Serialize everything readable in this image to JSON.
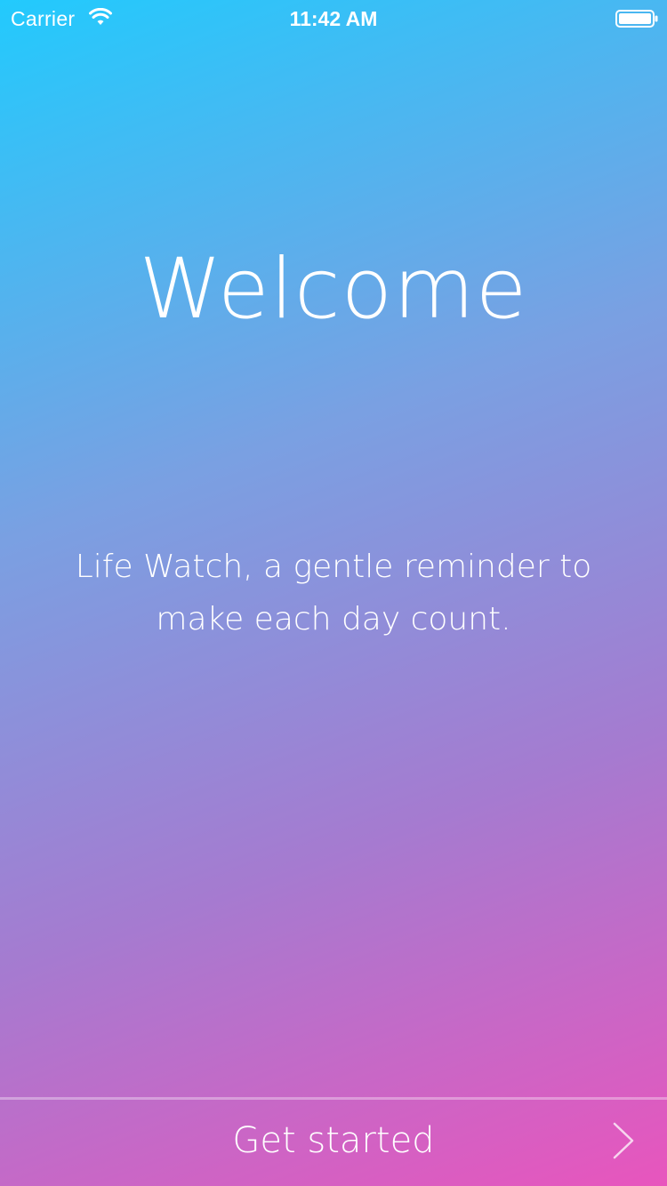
{
  "status_bar": {
    "carrier": "Carrier",
    "time": "11:42 AM",
    "wifi_icon": "wifi-icon",
    "battery_icon": "battery-icon"
  },
  "welcome": {
    "title": "Welcome",
    "tagline_line1": "Life Watch, a gentle reminder to",
    "tagline_line2": "make each day count."
  },
  "footer": {
    "get_started_label": "Get started",
    "chevron_icon": "chevron-right-icon"
  },
  "colors": {
    "gradient_top_left": "#22cafd",
    "gradient_bottom_right": "#e855bd",
    "text": "#ffffff"
  }
}
